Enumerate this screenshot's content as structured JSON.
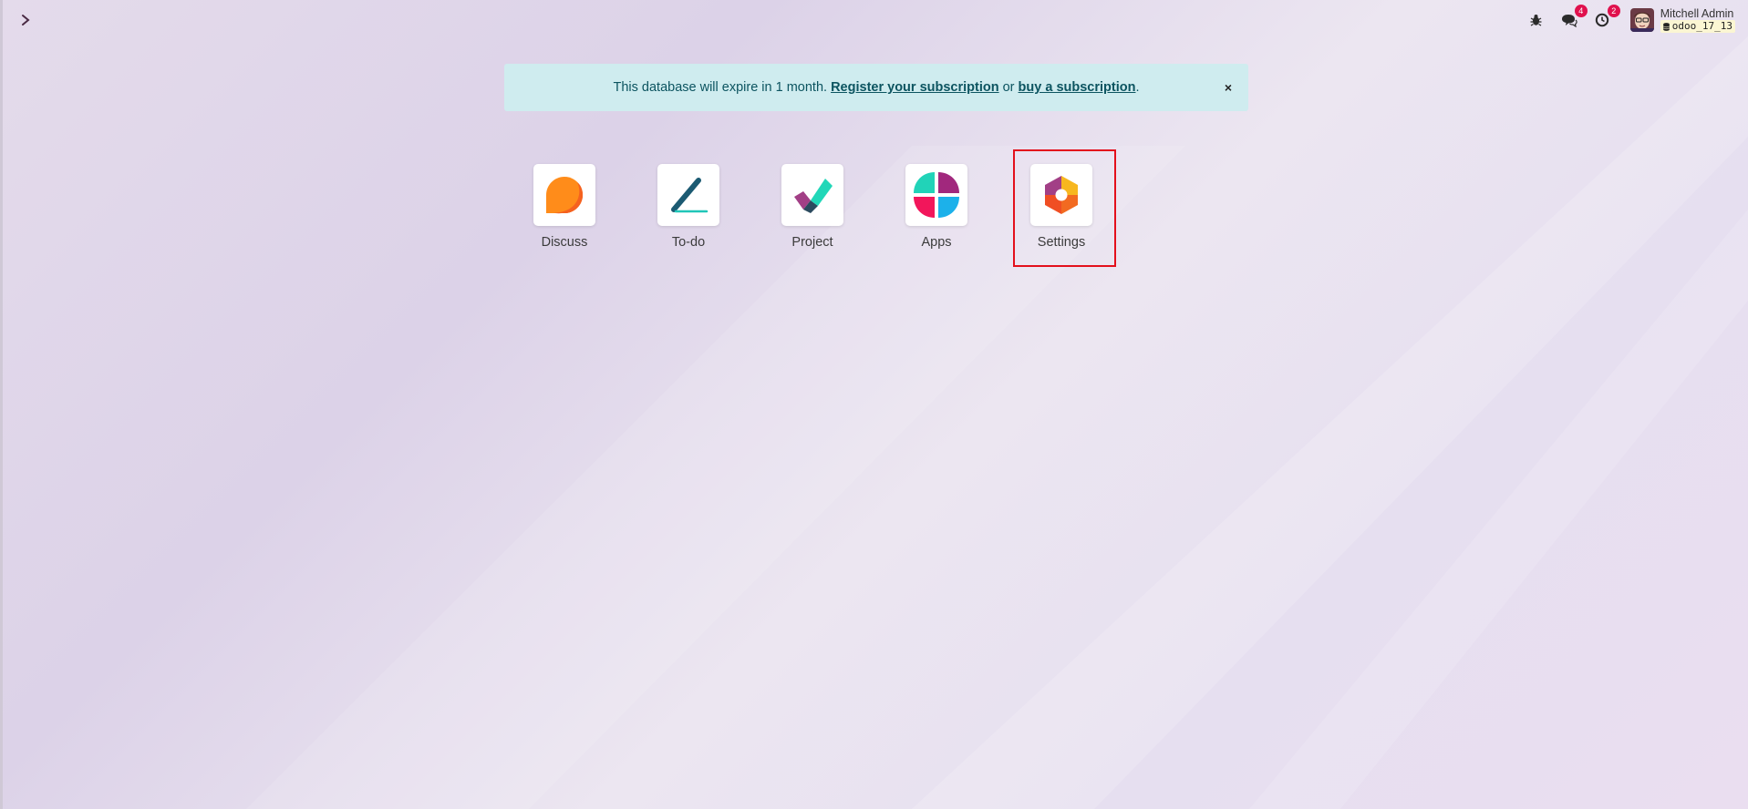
{
  "topbar": {
    "menu_toggle_icon": "chevron-right-icon",
    "debug_icon": "bug-icon",
    "messages_icon": "chat-icon",
    "messages_count": "4",
    "activities_icon": "clock-icon",
    "activities_count": "2",
    "user_name": "Mitchell Admin",
    "database_name": "odoo_17_13"
  },
  "banner": {
    "text_before": "This database will expire in 1 month. ",
    "register_link": "Register your subscription",
    "text_middle": " or ",
    "buy_link": "buy a subscription",
    "text_after": ".",
    "close_label": "×"
  },
  "apps": [
    {
      "label": "Discuss",
      "icon": "discuss-icon"
    },
    {
      "label": "To-do",
      "icon": "todo-icon"
    },
    {
      "label": "Project",
      "icon": "project-icon"
    },
    {
      "label": "Apps",
      "icon": "apps-icon"
    },
    {
      "label": "Settings",
      "icon": "settings-icon"
    }
  ],
  "colors": {
    "background": "#e4dbeb",
    "banner_bg": "#cfecef",
    "banner_text": "#0c5460",
    "badge": "#e0114d",
    "highlight": "#e3101c"
  }
}
